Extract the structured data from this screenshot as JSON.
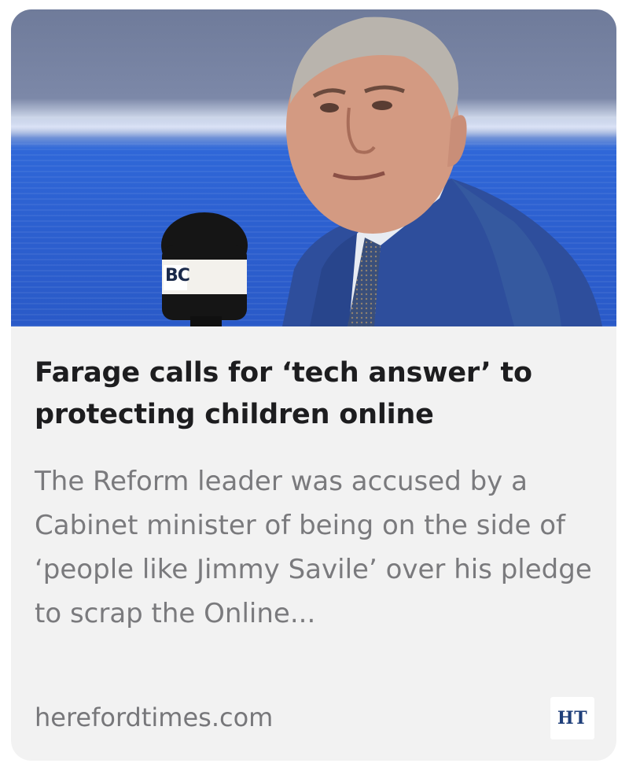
{
  "article": {
    "image_alt": "Man in blue suit beside LBC microphone",
    "mic_logo_text": "BC",
    "headline": "Farage calls for ‘tech answer’ to protecting children online",
    "summary": "The Reform leader was accused by a Cabinet minister of being on the side of ‘people like Jimmy Savile’ over his pledge to scrap the Online...",
    "source": "herefordtimes.com",
    "publisher_logo_text": "HT"
  },
  "colors": {
    "card_background": "#f2f2f2",
    "headline": "#1d1d1f",
    "summary": "#7a7a7d",
    "publisher_logo": "#1f3f7a"
  }
}
